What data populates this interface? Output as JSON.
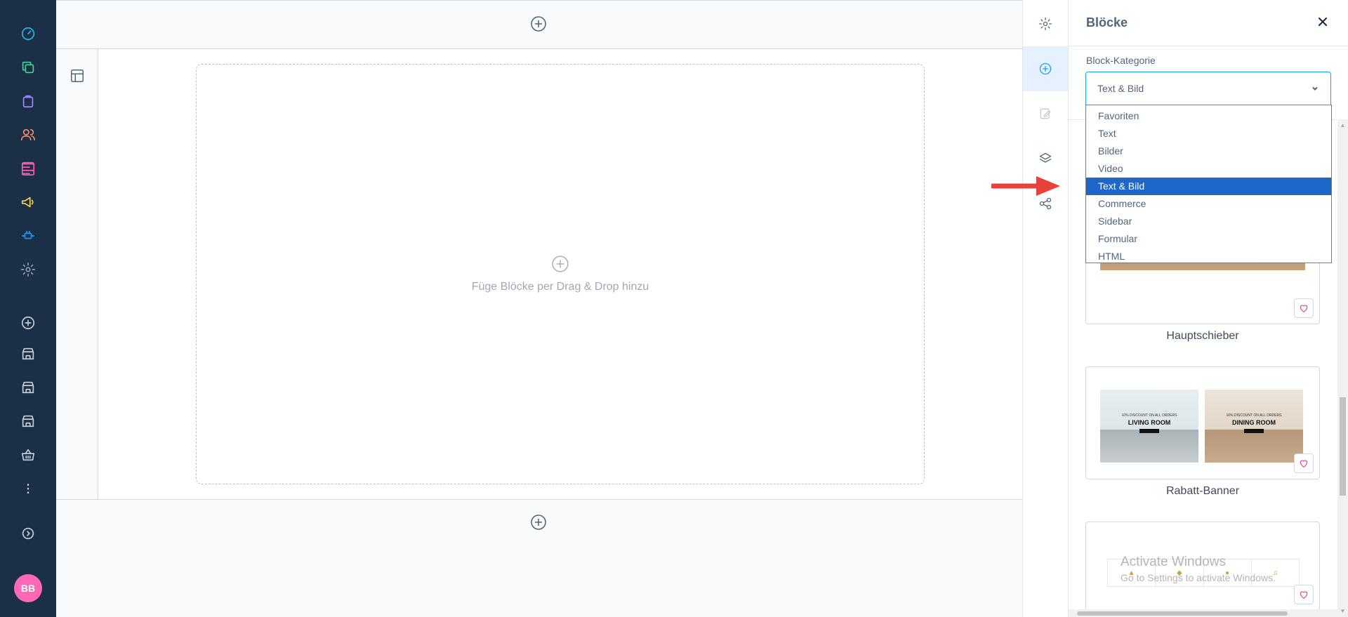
{
  "user": {
    "initials": "BB"
  },
  "canvas": {
    "dropzone_text": "Füge Blöcke per Drag & Drop hinzu"
  },
  "panel": {
    "title": "Blöcke",
    "category_label": "Block-Kategorie",
    "category_selected": "Text & Bild",
    "category_options": [
      "Favoriten",
      "Text",
      "Bilder",
      "Video",
      "Text & Bild",
      "Commerce",
      "Sidebar",
      "Formular",
      "HTML"
    ],
    "cards": [
      {
        "label": "Hauptschieber"
      },
      {
        "label": "Rabatt-Banner",
        "thumbs": [
          {
            "small": "10% DISCOUNT ON ALL ORDERS",
            "big": "LIVING ROOM"
          },
          {
            "small": "10% DISCOUNT ON ALL ORDERS",
            "big": "DINING ROOM"
          }
        ]
      },
      {
        "label": ""
      }
    ]
  },
  "watermark": {
    "title": "Activate Windows",
    "subtitle": "Go to Settings to activate Windows."
  },
  "colors": {
    "nav_bg": "#1b2f47",
    "accent": "#189eff",
    "selected_option": "#1e66c8",
    "annotation_arrow": "#e8413a",
    "avatar": "#ff68b4"
  }
}
